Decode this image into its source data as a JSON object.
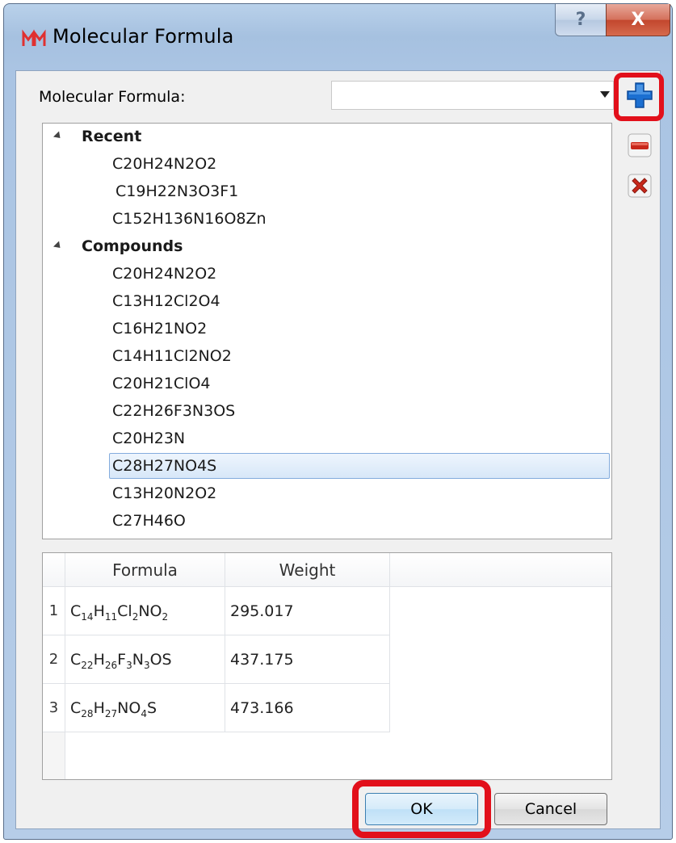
{
  "window": {
    "title": "Molecular Formula",
    "help_glyph": "?",
    "close_glyph": "X",
    "app_icon": "molecule-app-icon"
  },
  "form": {
    "formula_label": "Molecular Formula:",
    "formula_value": ""
  },
  "side_buttons": {
    "add_icon": "plus-icon",
    "remove_icon": "minus-icon",
    "delete_icon": "x-icon"
  },
  "tree": {
    "groups": [
      {
        "label": "Recent",
        "items": [
          "C20H24N2O2",
          "C19H22N3O3F1",
          "C152H136N16O8Zn"
        ]
      },
      {
        "label": "Compounds",
        "items": [
          "C20H24N2O2",
          "C13H12Cl2O4",
          "C16H21NO2",
          "C14H11Cl2NO2",
          "C20H21ClO4",
          "C22H26F3N3OS",
          "C20H23N",
          "C28H27NO4S",
          "C13H20N2O2",
          "C27H46O"
        ]
      }
    ],
    "selected_item": "C28H27NO4S"
  },
  "table": {
    "headers": [
      "Formula",
      "Weight"
    ],
    "rows": [
      {
        "index": "1",
        "formula": "C14H11Cl2NO2",
        "weight": "295.017"
      },
      {
        "index": "2",
        "formula": "C22H26F3N3OS",
        "weight": "437.175"
      },
      {
        "index": "3",
        "formula": "C28H27NO4S",
        "weight": "473.166"
      }
    ]
  },
  "buttons": {
    "ok": "OK",
    "cancel": "Cancel"
  },
  "colors": {
    "highlight": "#e2101b",
    "selection": "#d7e7f8",
    "plus_blue": "#1b6fd1",
    "minus_red": "#c8281b"
  }
}
